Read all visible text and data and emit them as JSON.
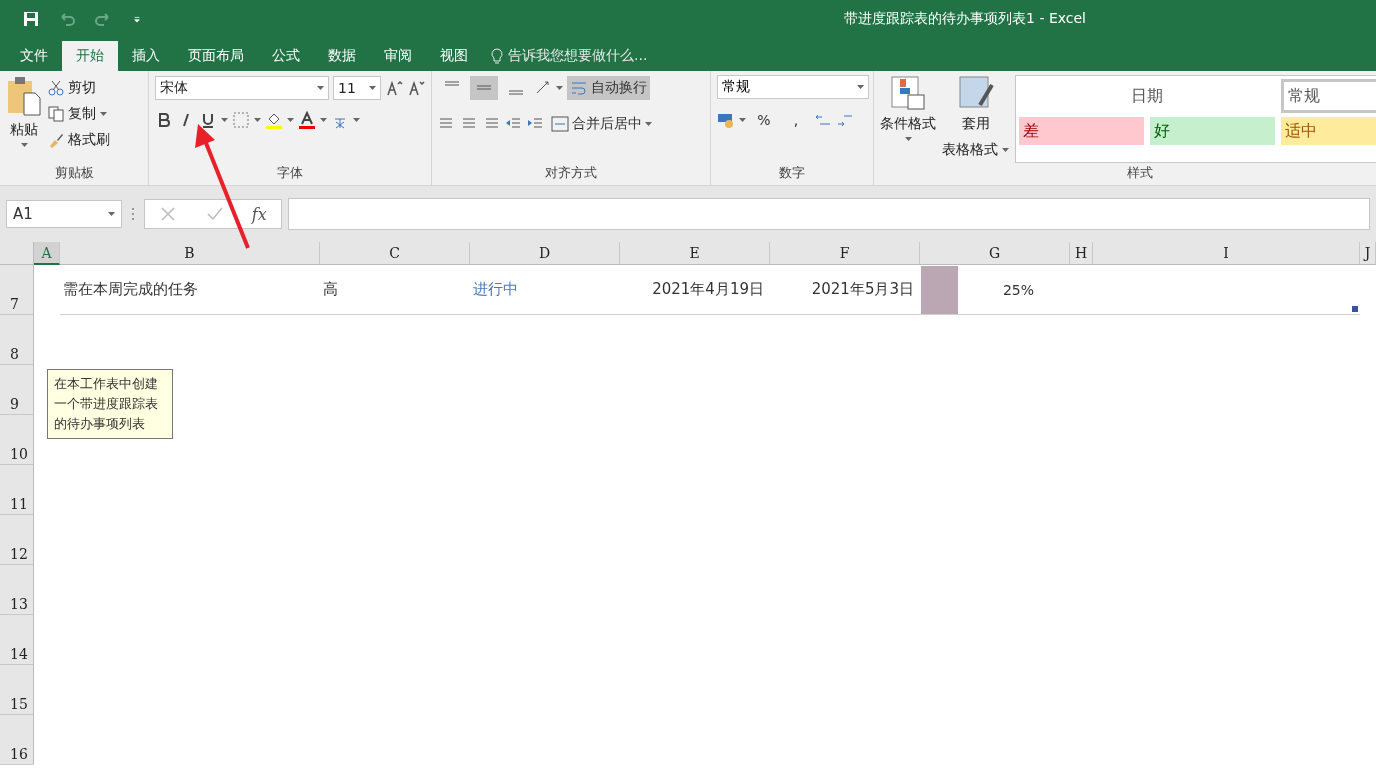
{
  "title_bar": {
    "title": "带进度跟踪表的待办事项列表1 - Excel"
  },
  "menu_tabs": [
    {
      "label": "文件",
      "selected": false
    },
    {
      "label": "开始",
      "selected": true
    },
    {
      "label": "插入",
      "selected": false
    },
    {
      "label": "页面布局",
      "selected": false
    },
    {
      "label": "公式",
      "selected": false
    },
    {
      "label": "数据",
      "selected": false
    },
    {
      "label": "审阅",
      "selected": false
    },
    {
      "label": "视图",
      "selected": false
    }
  ],
  "tell_me": {
    "placeholder": "告诉我您想要做什么..."
  },
  "ribbon": {
    "clipboard": {
      "paste": "粘贴",
      "cut": "剪切",
      "copy": "复制",
      "format_painter": "格式刷",
      "label": "剪贴板"
    },
    "font": {
      "font_name": "宋体",
      "font_size": "11",
      "label": "字体"
    },
    "alignment": {
      "wrap_text": {
        "label": "自动换行",
        "on": true
      },
      "middle_align_on": true,
      "merge": "合并后居中",
      "label": "对齐方式"
    },
    "number": {
      "format": "常规",
      "percent": "%",
      "comma": ",",
      "label": "数字"
    },
    "styles": {
      "conditional": "条件格式",
      "table_format_1": "套用",
      "table_format_2": "表格格式",
      "cells": [
        {
          "label": "日期",
          "kind": "date",
          "selected": false
        },
        {
          "label": "常规",
          "kind": "normal",
          "selected": true
        },
        {
          "label": "差",
          "kind": "bad",
          "selected": false
        },
        {
          "label": "好",
          "kind": "good",
          "selected": false
        },
        {
          "label": "适中",
          "kind": "neutral",
          "selected": false
        }
      ],
      "label": "样式"
    }
  },
  "formula_bar": {
    "name_box": "A1",
    "fx": "fx"
  },
  "columns": [
    {
      "label": "A",
      "selected": true
    },
    {
      "label": "B",
      "selected": false
    },
    {
      "label": "C",
      "selected": false
    },
    {
      "label": "D",
      "selected": false
    },
    {
      "label": "E",
      "selected": false
    },
    {
      "label": "F",
      "selected": false
    },
    {
      "label": "G",
      "selected": false
    },
    {
      "label": "H",
      "selected": false
    },
    {
      "label": "I",
      "selected": false
    },
    {
      "label": "J",
      "selected": false
    }
  ],
  "rows": [
    {
      "number": "7",
      "task": "需在本周完成的任务",
      "priority": "高",
      "status": "进行中",
      "start": "2021年4月19日",
      "due": "2021年5月3日",
      "level": 0.25,
      "percent": "25%"
    },
    {
      "number": "8"
    },
    {
      "number": "9"
    },
    {
      "number": "10"
    },
    {
      "number": "11"
    },
    {
      "number": "12"
    },
    {
      "number": "13"
    },
    {
      "number": "14"
    },
    {
      "number": "15"
    },
    {
      "number": "16"
    }
  ],
  "comment": {
    "text": "在本工作表中创建一个带进度跟踪表的待办事项列表"
  }
}
